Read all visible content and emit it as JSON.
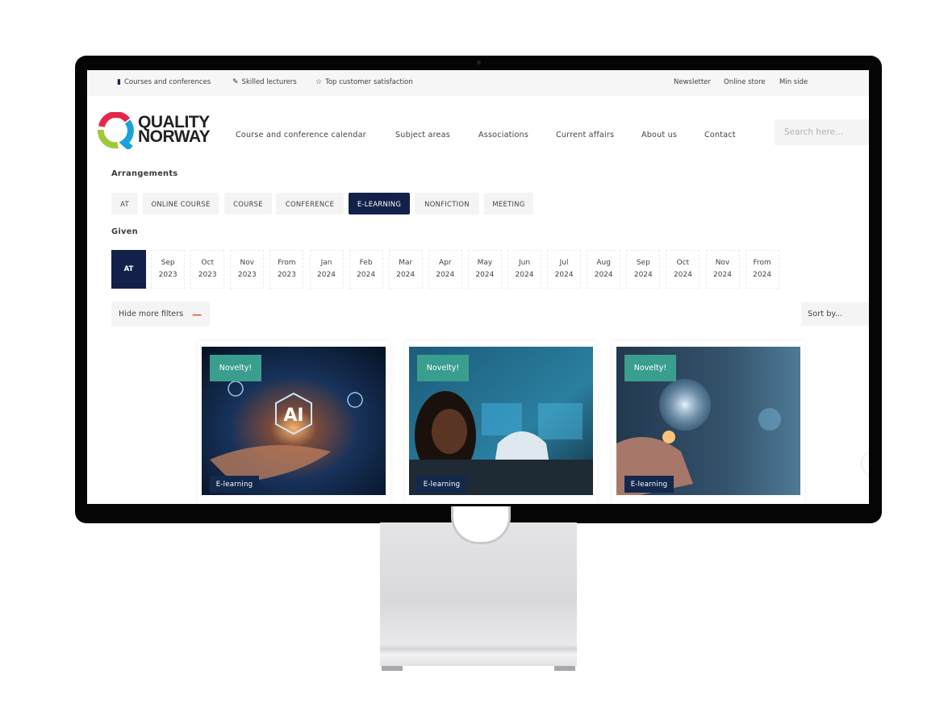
{
  "topbar": {
    "left": [
      {
        "icon": "book-icon",
        "label": "Courses and conferences"
      },
      {
        "icon": "lecturer-icon",
        "label": "Skilled lecturers"
      },
      {
        "icon": "star-icon",
        "label": "Top customer satisfaction"
      }
    ],
    "right": [
      "Newsletter",
      "Online store",
      "Min side"
    ]
  },
  "brand": {
    "line1": "QUALITY",
    "line2": "NORWAY",
    "colors": {
      "red": "#e4274a",
      "green": "#9ec93c",
      "blue": "#1aa3d9"
    }
  },
  "nav": [
    "Course and conference calendar",
    "Subject areas",
    "Associations",
    "Current affairs",
    "About us",
    "Contact"
  ],
  "search": {
    "placeholder": "Search here..."
  },
  "arrangements": {
    "label": "Arrangements",
    "options": [
      "AT",
      "ONLINE COURSE",
      "COURSE",
      "CONFERENCE",
      "E-LEARNING",
      "NONFICTION",
      "MEETING"
    ],
    "selected": "E-LEARNING"
  },
  "given": {
    "label": "Given",
    "options": [
      {
        "m": "AT",
        "y": ""
      },
      {
        "m": "Sep",
        "y": "2023"
      },
      {
        "m": "Oct",
        "y": "2023"
      },
      {
        "m": "Nov",
        "y": "2023"
      },
      {
        "m": "From",
        "y": "2023"
      },
      {
        "m": "Jan",
        "y": "2024"
      },
      {
        "m": "Feb",
        "y": "2024"
      },
      {
        "m": "Mar",
        "y": "2024"
      },
      {
        "m": "Apr",
        "y": "2024"
      },
      {
        "m": "May",
        "y": "2024"
      },
      {
        "m": "Jun",
        "y": "2024"
      },
      {
        "m": "Jul",
        "y": "2024"
      },
      {
        "m": "Aug",
        "y": "2024"
      },
      {
        "m": "Sep",
        "y": "2024"
      },
      {
        "m": "Oct",
        "y": "2024"
      },
      {
        "m": "Nov",
        "y": "2024"
      },
      {
        "m": "From",
        "y": "2024"
      }
    ],
    "selected": "AT"
  },
  "filters": {
    "hide_label": "Hide more filters",
    "sort_label": "Sort by..."
  },
  "cards": [
    {
      "badge": "Novelty!",
      "type": "E-learning",
      "image": "ai-hand-image"
    },
    {
      "badge": "Novelty!",
      "type": "E-learning",
      "image": "control-room-image"
    },
    {
      "badge": "Novelty!",
      "type": "E-learning",
      "image": "digital-globe-image"
    }
  ],
  "colors": {
    "primary": "#13214a",
    "accent": "#3a9e8f",
    "minus": "#e05a2a"
  }
}
